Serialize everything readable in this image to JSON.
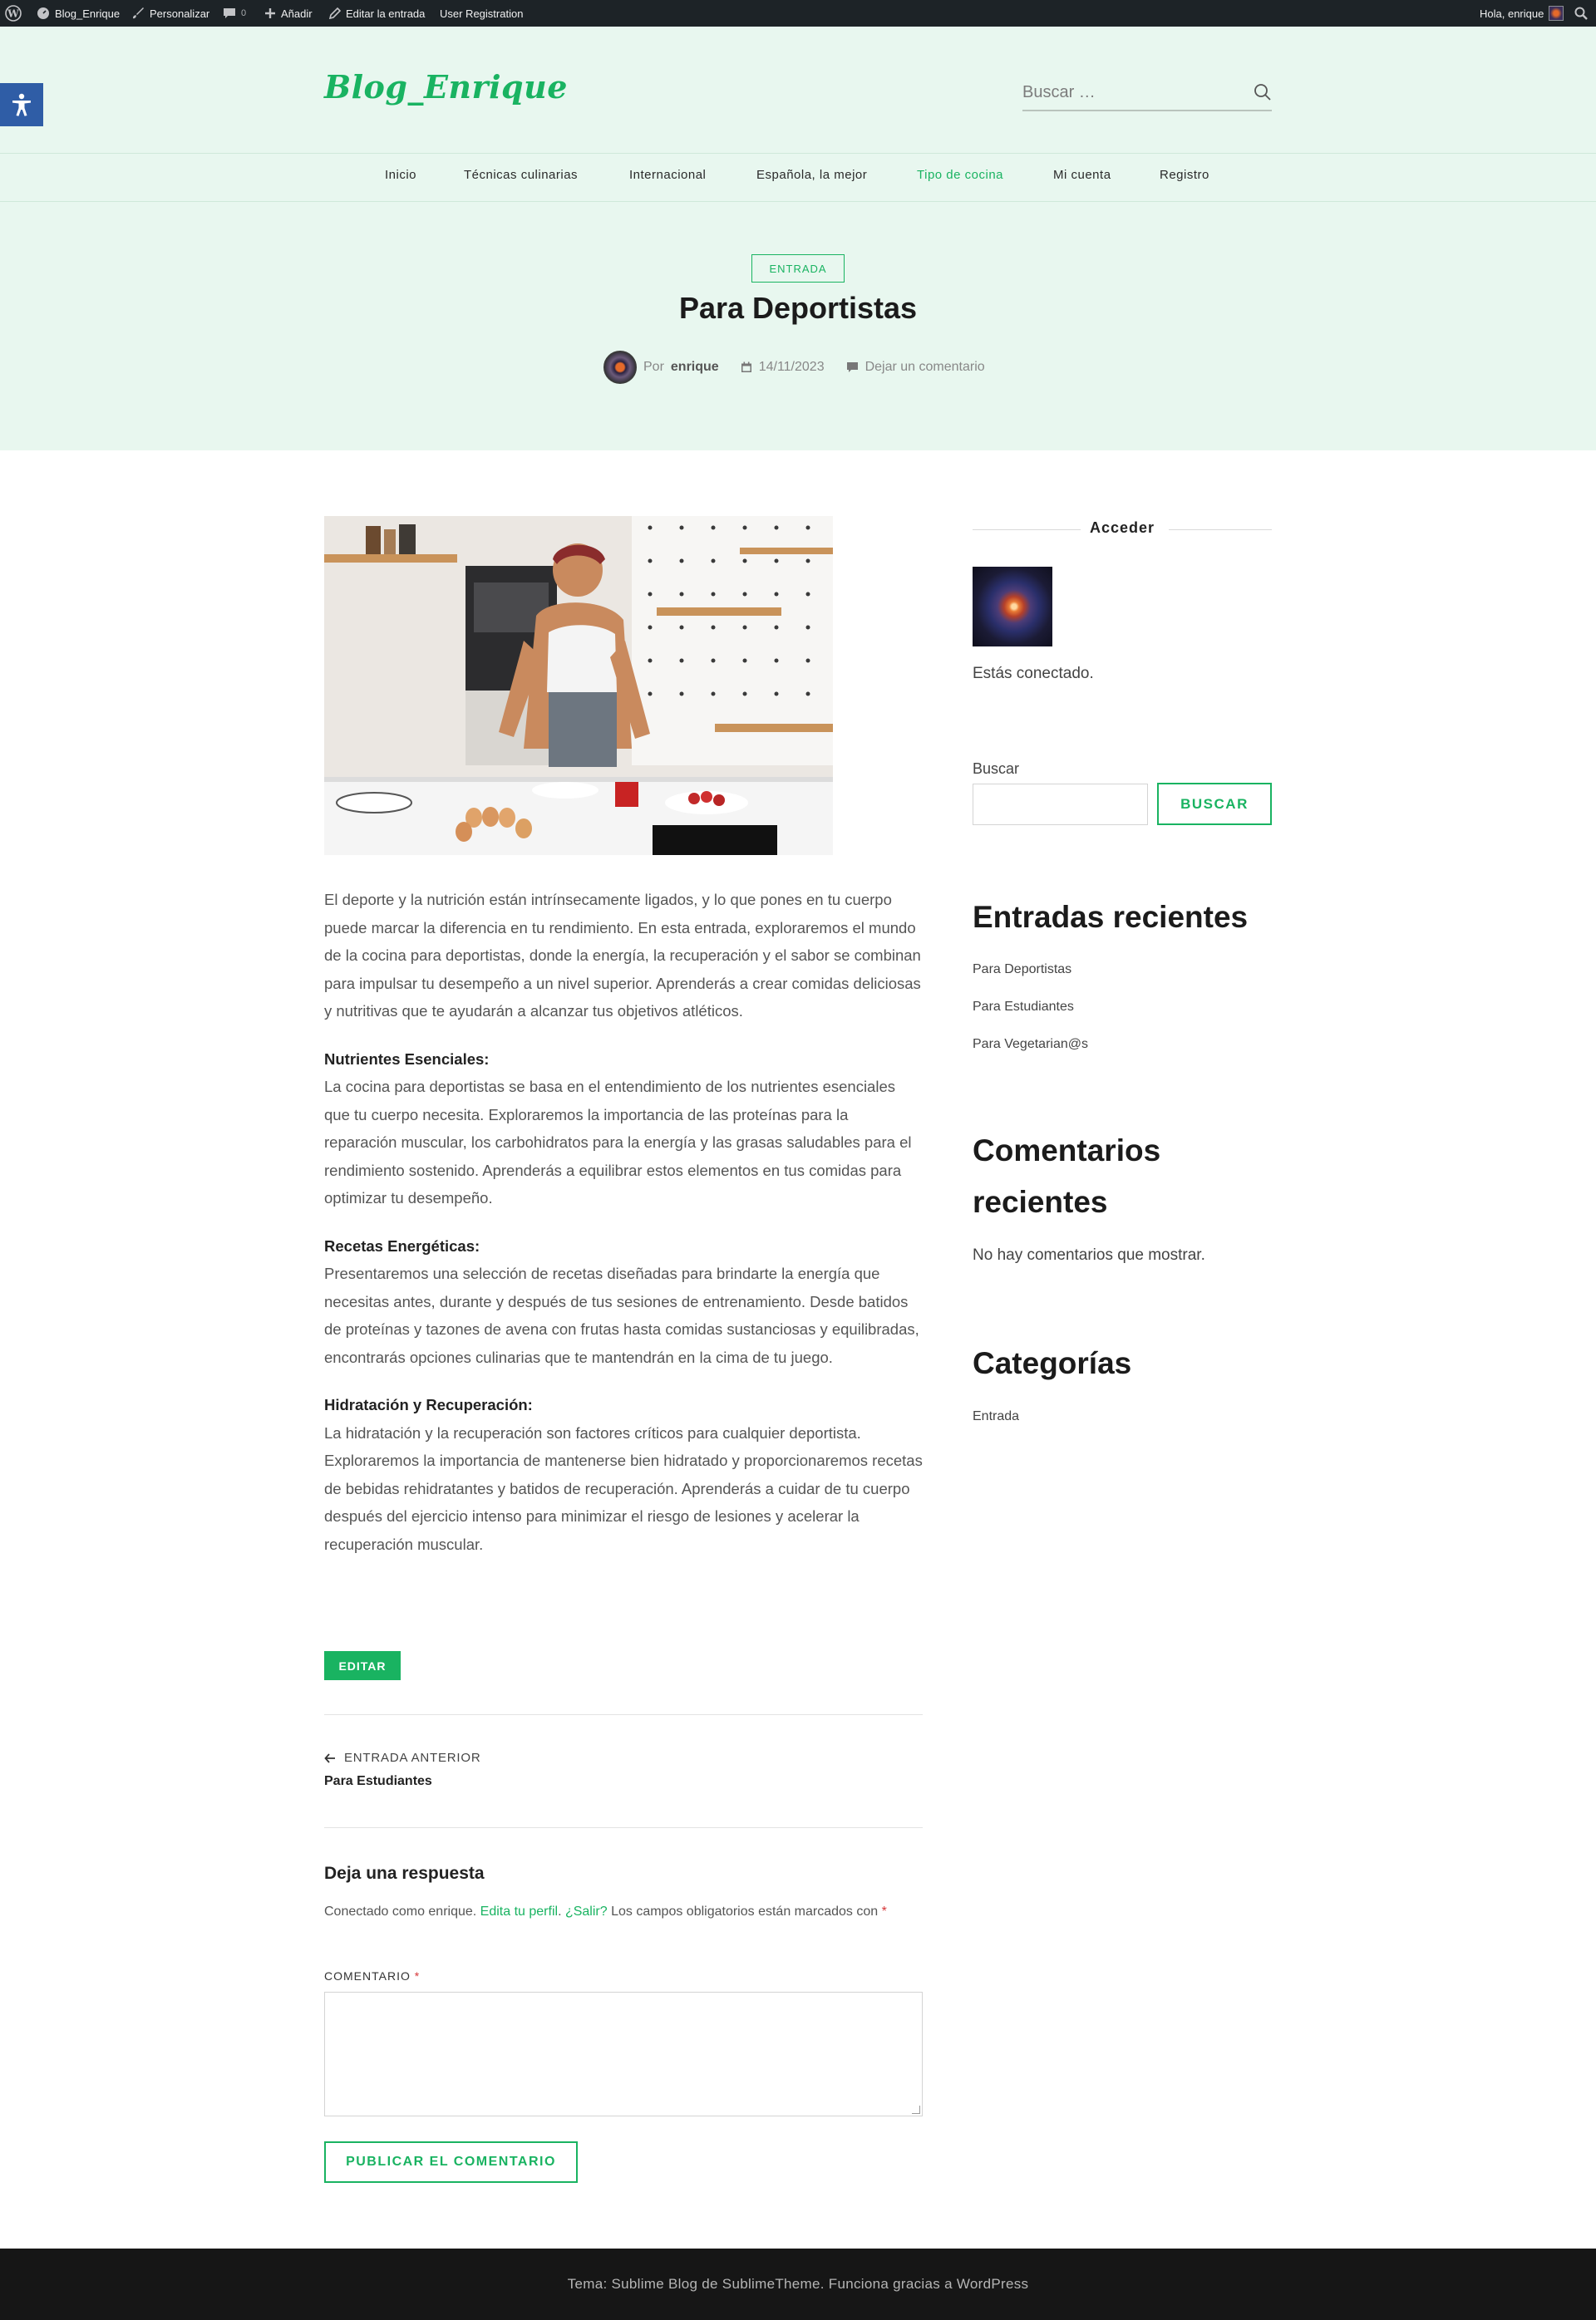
{
  "adminbar": {
    "site_name": "Blog_Enrique",
    "customize": "Personalizar",
    "comments_count": "0",
    "new": "Añadir",
    "edit_post": "Editar la entrada",
    "user_registration": "User Registration",
    "greeting": "Hola, enrique"
  },
  "header": {
    "site_title": "Blog_Enrique",
    "search_placeholder": "Buscar …",
    "menu": [
      "Inicio",
      "Técnicas culinarias",
      "Internacional",
      "Española, la mejor",
      "Tipo de cocina",
      "Mi cuenta",
      "Registro"
    ],
    "active_menu": "Tipo de cocina"
  },
  "post": {
    "category": "ENTRADA",
    "title": "Para Deportistas",
    "by_label": "Por",
    "author": "enrique",
    "date": "14/11/2023",
    "comment_link": "Dejar un comentario",
    "intro": "El deporte y la nutrición están intrínsecamente ligados, y lo que pones en tu cuerpo puede marcar la diferencia en tu rendimiento. En esta entrada, exploraremos el mundo de la cocina para deportistas, donde la energía, la recuperación y el sabor se combinan para impulsar tu desempeño a un nivel superior. Aprenderás a crear comidas deliciosas y nutritivas que te ayudarán a alcanzar tus objetivos atléticos.",
    "sections": [
      {
        "heading": "Nutrientes Esenciales:",
        "body": "La cocina para deportistas se basa en el entendimiento de los nutrientes esenciales que tu cuerpo necesita. Exploraremos la importancia de las proteínas para la reparación muscular, los carbohidratos para la energía y las grasas saludables para el rendimiento sostenido. Aprenderás a equilibrar estos elementos en tus comidas para optimizar tu desempeño."
      },
      {
        "heading": "Recetas Energéticas:",
        "body": "Presentaremos una selección de recetas diseñadas para brindarte la energía que necesitas antes, durante y después de tus sesiones de entrenamiento. Desde batidos de proteínas y tazones de avena con frutas hasta comidas sustanciosas y equilibradas, encontrarás opciones culinarias que te mantendrán en la cima de tu juego."
      },
      {
        "heading": "Hidratación y Recuperación:",
        "body": "La hidratación y la recuperación son factores críticos para cualquier deportista. Exploraremos la importancia de mantenerse bien hidratado y proporcionaremos recetas de bebidas rehidratantes y batidos de recuperación. Aprenderás a cuidar de tu cuerpo después del ejercicio intenso para minimizar el riesgo de lesiones y acelerar la recuperación muscular."
      }
    ],
    "edit_button": "EDITAR",
    "prev_label": "ENTRADA ANTERIOR",
    "prev_title": "Para Estudiantes"
  },
  "reply": {
    "title": "Deja una respuesta",
    "logged_prefix": "Conectado como enrique. ",
    "edit_profile": "Edita tu perfil",
    "logout": "¿Salir?",
    "required_note": " Los campos obligatorios están marcados con ",
    "required_mark": "*",
    "comment_label": "COMENTARIO",
    "publish_button": "PUBLICAR EL COMENTARIO"
  },
  "sidebar": {
    "login_title": "Acceder",
    "connected_text": "Estás conectado.",
    "search_label": "Buscar",
    "search_button": "BUSCAR",
    "recent_posts_title": "Entradas recientes",
    "recent_posts": [
      "Para Deportistas",
      "Para Estudiantes",
      "Para Vegetarian@s"
    ],
    "recent_comments_title_1": "Comentarios",
    "recent_comments_title_2": "recientes",
    "no_comments": "No hay comentarios que mostrar.",
    "categories_title": "Categorías",
    "categories": [
      "Entrada"
    ]
  },
  "footer": {
    "text": "Tema: Sublime Blog de SublimeTheme. Funciona gracias a WordPress"
  },
  "colors": {
    "accent": "#19b361",
    "header_bg": "#e8f7ef",
    "adminbar_bg": "#1d2327",
    "footer_bg": "#161616",
    "accessibility_btn": "#2f5da6"
  }
}
